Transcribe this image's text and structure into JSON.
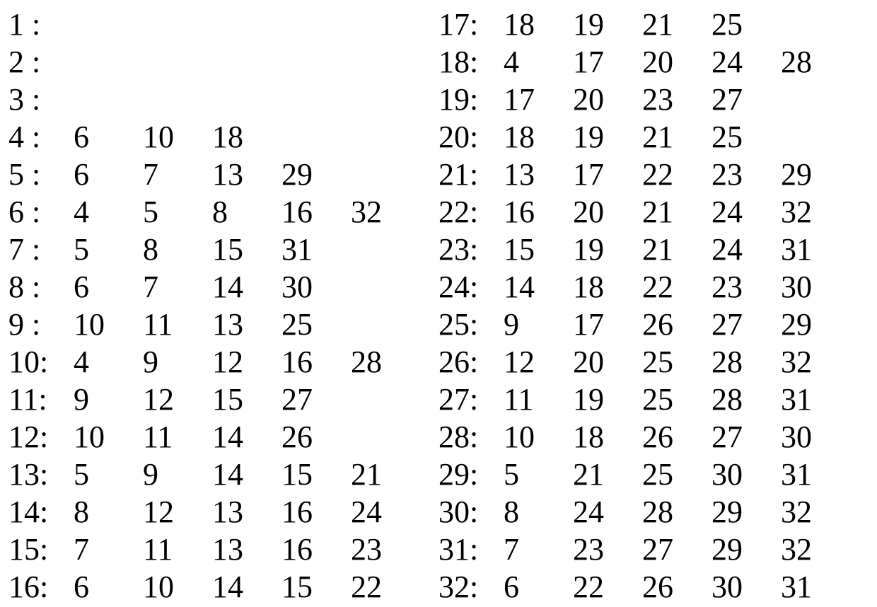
{
  "columns": [
    {
      "rows": [
        {
          "label": "1 :",
          "values": []
        },
        {
          "label": "2 :",
          "values": []
        },
        {
          "label": "3 :",
          "values": []
        },
        {
          "label": "4 :",
          "values": [
            "6",
            "10",
            "18"
          ]
        },
        {
          "label": "5 :",
          "values": [
            "6",
            "7",
            "13",
            "29"
          ]
        },
        {
          "label": "6 :",
          "values": [
            "4",
            "5",
            "8",
            "16",
            "32"
          ]
        },
        {
          "label": "7 :",
          "values": [
            "5",
            "8",
            "15",
            "31"
          ]
        },
        {
          "label": "8 :",
          "values": [
            "6",
            "7",
            "14",
            "30"
          ]
        },
        {
          "label": "9 :",
          "values": [
            "10",
            "11",
            "13",
            "25"
          ]
        },
        {
          "label": "10:",
          "values": [
            "4",
            "9",
            "12",
            "16",
            "28"
          ]
        },
        {
          "label": "11:",
          "values": [
            "9",
            "12",
            "15",
            "27"
          ]
        },
        {
          "label": "12:",
          "values": [
            "10",
            "11",
            "14",
            "26"
          ]
        },
        {
          "label": "13:",
          "values": [
            "5",
            "9",
            "14",
            "15",
            "21"
          ]
        },
        {
          "label": "14:",
          "values": [
            "8",
            "12",
            "13",
            "16",
            "24"
          ]
        },
        {
          "label": "15:",
          "values": [
            "7",
            "11",
            "13",
            "16",
            "23"
          ]
        },
        {
          "label": "16:",
          "values": [
            "6",
            "10",
            "14",
            "15",
            "22"
          ]
        }
      ]
    },
    {
      "rows": [
        {
          "label": "17:",
          "values": [
            "18",
            "19",
            "21",
            "25"
          ]
        },
        {
          "label": "18:",
          "values": [
            "4",
            "17",
            "20",
            "24",
            "28"
          ]
        },
        {
          "label": "19:",
          "values": [
            "17",
            "20",
            "23",
            "27"
          ]
        },
        {
          "label": "20:",
          "values": [
            "18",
            "19",
            "21",
            "25"
          ]
        },
        {
          "label": "21:",
          "values": [
            "13",
            "17",
            "22",
            "23",
            "29"
          ]
        },
        {
          "label": "22:",
          "values": [
            "16",
            "20",
            "21",
            "24",
            "32"
          ]
        },
        {
          "label": "23:",
          "values": [
            "15",
            "19",
            "21",
            "24",
            "31"
          ]
        },
        {
          "label": "24:",
          "values": [
            "14",
            "18",
            "22",
            "23",
            "30"
          ]
        },
        {
          "label": "25:",
          "values": [
            "9",
            "17",
            "26",
            "27",
            "29"
          ]
        },
        {
          "label": "26:",
          "values": [
            "12",
            "20",
            "25",
            "28",
            "32"
          ]
        },
        {
          "label": "27:",
          "values": [
            "11",
            "19",
            "25",
            "28",
            "31"
          ]
        },
        {
          "label": "28:",
          "values": [
            "10",
            "18",
            "26",
            "27",
            "30"
          ]
        },
        {
          "label": "29:",
          "values": [
            "5",
            "21",
            "25",
            "30",
            "31"
          ]
        },
        {
          "label": "30:",
          "values": [
            "8",
            "24",
            "28",
            "29",
            "32"
          ]
        },
        {
          "label": "31:",
          "values": [
            "7",
            "23",
            "27",
            "29",
            "32"
          ]
        },
        {
          "label": "32:",
          "values": [
            "6",
            "22",
            "26",
            "30",
            "31"
          ]
        }
      ]
    }
  ]
}
